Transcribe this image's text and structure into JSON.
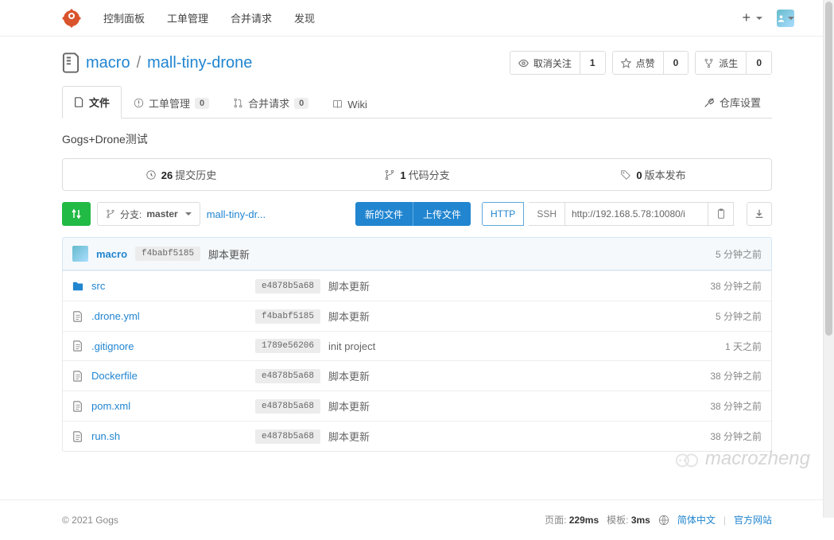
{
  "nav": {
    "items": [
      "控制面板",
      "工单管理",
      "合并请求",
      "发现"
    ]
  },
  "repo": {
    "owner": "macro",
    "slash": "/",
    "name": "mall-tiny-drone",
    "description": "Gogs+Drone测试"
  },
  "counters": {
    "watch": {
      "label": "取消关注",
      "count": "1"
    },
    "star": {
      "label": "点赞",
      "count": "0"
    },
    "fork": {
      "label": "派生",
      "count": "0"
    }
  },
  "tabs": {
    "files": "文件",
    "issues": "工单管理",
    "issues_count": "0",
    "prs": "合并请求",
    "prs_count": "0",
    "wiki": "Wiki",
    "settings": "仓库设置"
  },
  "stats": {
    "commits_num": "26",
    "commits_label": "提交历史",
    "branches_num": "1",
    "branches_label": "代码分支",
    "releases_num": "0",
    "releases_label": "版本发布"
  },
  "toolbar": {
    "branch_prefix": "分支:",
    "branch": "master",
    "breadcrumb": "mall-tiny-dr...",
    "new_file": "新的文件",
    "upload_file": "上传文件",
    "http": "HTTP",
    "ssh": "SSH",
    "clone_url": "http://192.168.5.78:10080/i"
  },
  "latest_commit": {
    "author": "macro",
    "sha": "f4babf5185",
    "message": "脚本更新",
    "time": "5 分钟之前"
  },
  "files": [
    {
      "type": "dir",
      "name": "src",
      "sha": "e4878b5a68",
      "msg": "脚本更新",
      "time": "38 分钟之前"
    },
    {
      "type": "file",
      "name": ".drone.yml",
      "sha": "f4babf5185",
      "msg": "脚本更新",
      "time": "5 分钟之前"
    },
    {
      "type": "file",
      "name": ".gitignore",
      "sha": "1789e56206",
      "msg": "init project",
      "time": "1 天之前"
    },
    {
      "type": "file",
      "name": "Dockerfile",
      "sha": "e4878b5a68",
      "msg": "脚本更新",
      "time": "38 分钟之前"
    },
    {
      "type": "file",
      "name": "pom.xml",
      "sha": "e4878b5a68",
      "msg": "脚本更新",
      "time": "38 分钟之前"
    },
    {
      "type": "file",
      "name": "run.sh",
      "sha": "e4878b5a68",
      "msg": "脚本更新",
      "time": "38 分钟之前"
    }
  ],
  "footer": {
    "copyright": "© 2021 Gogs",
    "page_label": "页面:",
    "page_time": "229ms",
    "tpl_label": "模板:",
    "tpl_time": "3ms",
    "lang": "简体中文",
    "site": "官方网站"
  },
  "watermark": "macrozheng"
}
